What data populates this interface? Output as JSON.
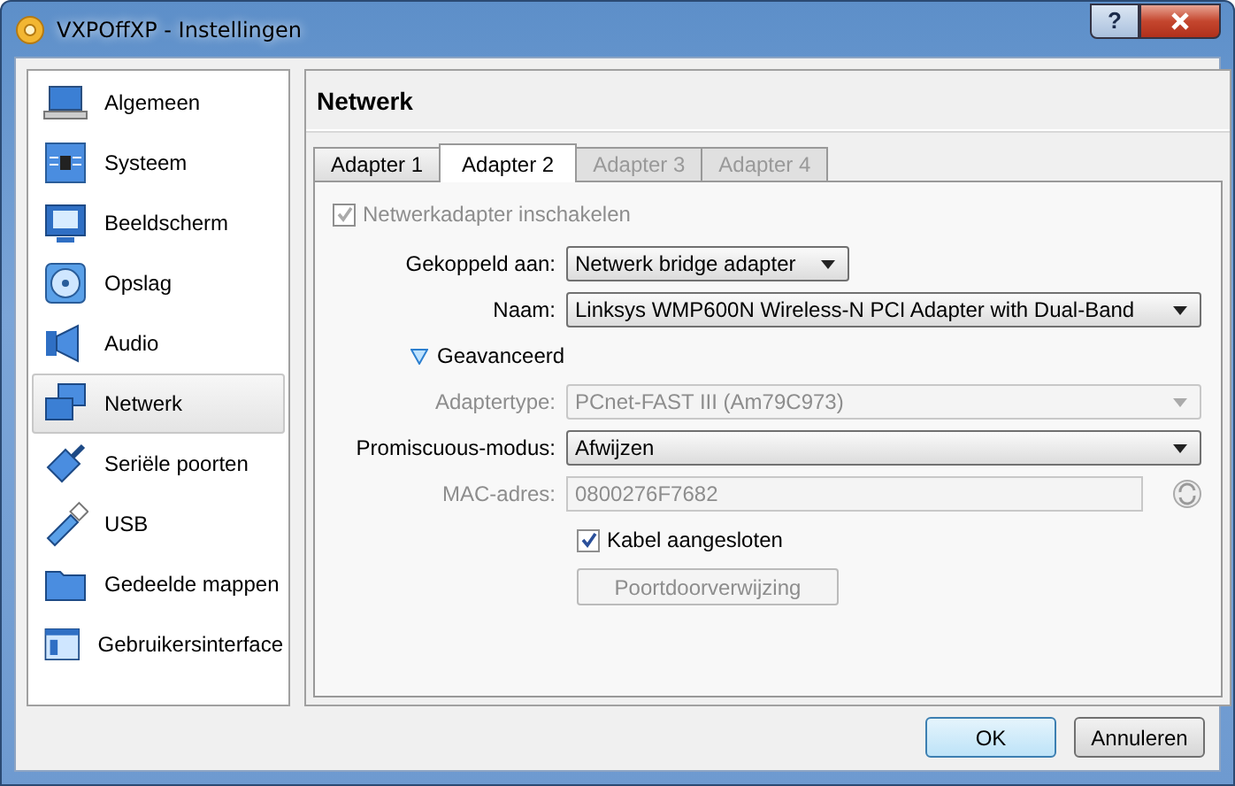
{
  "window": {
    "title": "VXPOffXP - Instellingen",
    "help_button": "?"
  },
  "sidebar": {
    "items": [
      {
        "label": "Algemeen",
        "selected": false
      },
      {
        "label": "Systeem",
        "selected": false
      },
      {
        "label": "Beeldscherm",
        "selected": false
      },
      {
        "label": "Opslag",
        "selected": false
      },
      {
        "label": "Audio",
        "selected": false
      },
      {
        "label": "Netwerk",
        "selected": true
      },
      {
        "label": "Seriële poorten",
        "selected": false
      },
      {
        "label": "USB",
        "selected": false
      },
      {
        "label": "Gedeelde mappen",
        "selected": false
      },
      {
        "label": "Gebruikersinterface",
        "selected": false
      }
    ]
  },
  "panel": {
    "title": "Netwerk",
    "tabs": [
      {
        "label": "Adapter 1",
        "selected": false,
        "disabled": false
      },
      {
        "label": "Adapter 2",
        "selected": true,
        "disabled": false
      },
      {
        "label": "Adapter 3",
        "selected": false,
        "disabled": true
      },
      {
        "label": "Adapter 4",
        "selected": false,
        "disabled": true
      }
    ],
    "rows": [
      {
        "kind": "checkbox",
        "label": "Netwerkadapter inschakelen",
        "checked": true,
        "disabled": true
      },
      {
        "kind": "select",
        "label": "Gekoppeld aan:",
        "value": "Netwerk bridge adapter",
        "disabled": false,
        "wide": false
      },
      {
        "kind": "select",
        "label": "Naam:",
        "value": "Linksys WMP600N Wireless-N PCI Adapter with Dual-Band",
        "disabled": false,
        "wide": true
      },
      {
        "kind": "toggle",
        "label": "Geavanceerd",
        "expanded": true
      },
      {
        "kind": "select",
        "label": "Adaptertype:",
        "value": "PCnet-FAST III (Am79C973)",
        "disabled": true,
        "wide": true
      },
      {
        "kind": "select",
        "label": "Promiscuous-modus:",
        "value": "Afwijzen",
        "disabled": false,
        "wide": true
      },
      {
        "kind": "text",
        "label": "MAC-adres:",
        "value": "0800276F7682",
        "disabled": true
      },
      {
        "kind": "checkbox",
        "label": "Kabel aangesloten",
        "checked": true,
        "disabled": false
      },
      {
        "kind": "button",
        "label": "Poortdoorverwijzing",
        "disabled": true
      }
    ]
  },
  "buttons": [
    {
      "label": "OK",
      "default": true
    },
    {
      "label": "Annuleren",
      "default": false
    }
  ]
}
